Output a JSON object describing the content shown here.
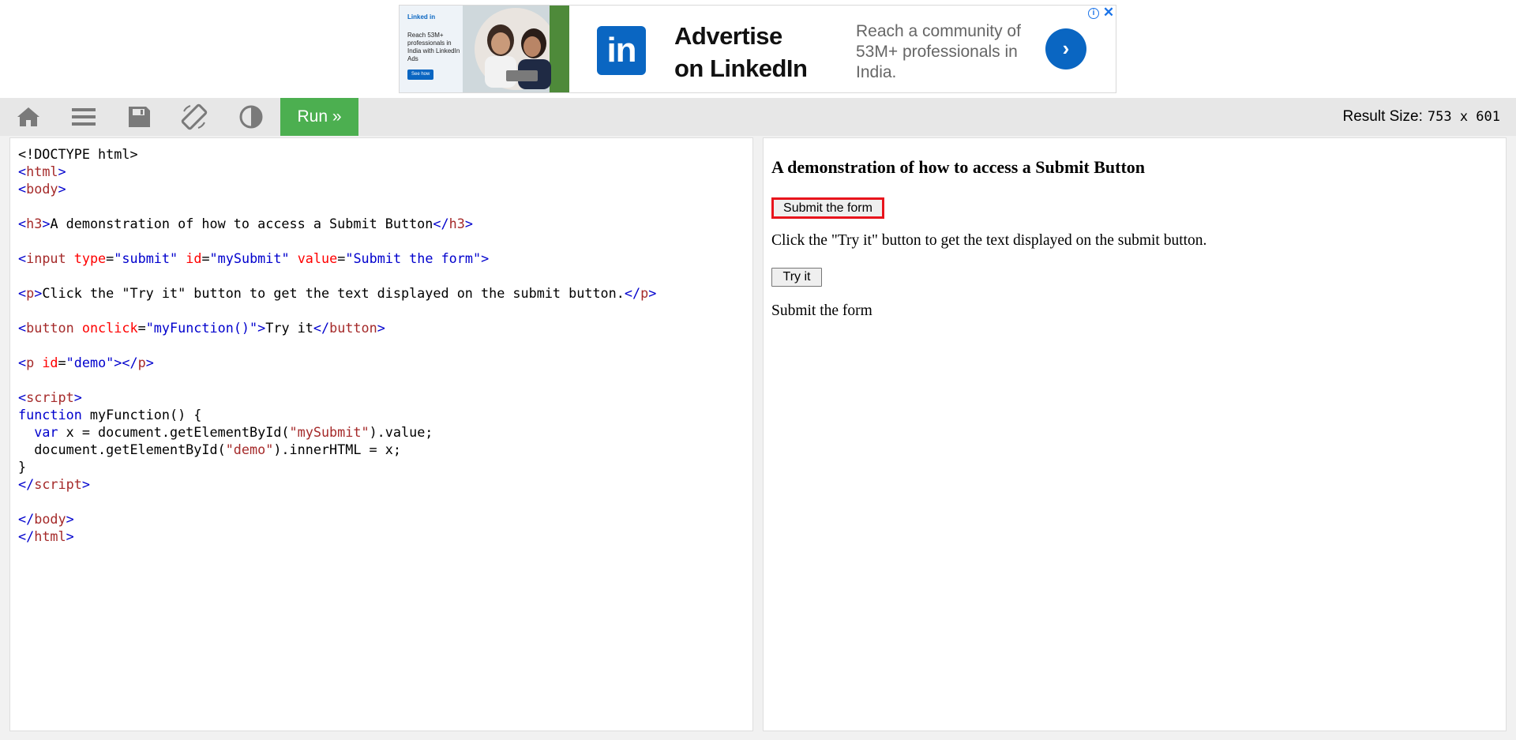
{
  "ad": {
    "thumb_brand": "Linked in",
    "thumb_headline": "Reach 53M+ professionals in India with LinkedIn Ads",
    "thumb_cta": "See how",
    "logo_text": "in",
    "title": "Advertise on LinkedIn",
    "description": "Reach a community of 53M+ professionals in India.",
    "arrow": "›",
    "info": "i",
    "close": "✕"
  },
  "toolbar": {
    "icons": [
      "home-icon",
      "menu-icon",
      "save-icon",
      "rotate-icon",
      "contrast-icon"
    ],
    "run_label": "Run »",
    "result_size_label": "Result Size:",
    "result_size_value": "753 x 601"
  },
  "colors": {
    "tag": "#a52a2a",
    "bracket": "#0000cd",
    "attr": "#ff0000",
    "value": "#0000cd",
    "keyword": "#0000cd",
    "string": "#a52a2a",
    "run_green": "#4caf50",
    "highlight_red": "#e8141c"
  },
  "code_lines": [
    [
      [
        "t",
        "<!DOCTYPE html>"
      ]
    ],
    [
      [
        "b",
        "<"
      ],
      [
        "g",
        "html"
      ],
      [
        "b",
        ">"
      ]
    ],
    [
      [
        "b",
        "<"
      ],
      [
        "g",
        "body"
      ],
      [
        "b",
        ">"
      ]
    ],
    [],
    [
      [
        "b",
        "<"
      ],
      [
        "g",
        "h3"
      ],
      [
        "b",
        ">"
      ],
      [
        "t",
        "A demonstration of how to access a Submit Button"
      ],
      [
        "b",
        "</"
      ],
      [
        "g",
        "h3"
      ],
      [
        "b",
        ">"
      ]
    ],
    [],
    [
      [
        "b",
        "<"
      ],
      [
        "g",
        "input"
      ],
      [
        "t",
        " "
      ],
      [
        "a",
        "type"
      ],
      [
        "t",
        "="
      ],
      [
        "v",
        "\"submit\""
      ],
      [
        "t",
        " "
      ],
      [
        "a",
        "id"
      ],
      [
        "t",
        "="
      ],
      [
        "v",
        "\"mySubmit\""
      ],
      [
        "t",
        " "
      ],
      [
        "a",
        "value"
      ],
      [
        "t",
        "="
      ],
      [
        "v",
        "\"Submit the form\""
      ],
      [
        "b",
        ">"
      ]
    ],
    [],
    [
      [
        "b",
        "<"
      ],
      [
        "g",
        "p"
      ],
      [
        "b",
        ">"
      ],
      [
        "t",
        "Click the \"Try it\" button to get the text displayed on the submit button."
      ],
      [
        "b",
        "</"
      ],
      [
        "g",
        "p"
      ],
      [
        "b",
        ">"
      ]
    ],
    [],
    [
      [
        "b",
        "<"
      ],
      [
        "g",
        "button"
      ],
      [
        "t",
        " "
      ],
      [
        "a",
        "onclick"
      ],
      [
        "t",
        "="
      ],
      [
        "v",
        "\"myFunction()\""
      ],
      [
        "b",
        ">"
      ],
      [
        "t",
        "Try it"
      ],
      [
        "b",
        "</"
      ],
      [
        "g",
        "button"
      ],
      [
        "b",
        ">"
      ]
    ],
    [],
    [
      [
        "b",
        "<"
      ],
      [
        "g",
        "p"
      ],
      [
        "t",
        " "
      ],
      [
        "a",
        "id"
      ],
      [
        "t",
        "="
      ],
      [
        "v",
        "\"demo\""
      ],
      [
        "b",
        "></"
      ],
      [
        "g",
        "p"
      ],
      [
        "b",
        ">"
      ]
    ],
    [],
    [
      [
        "b",
        "<"
      ],
      [
        "g",
        "script"
      ],
      [
        "b",
        ">"
      ]
    ],
    [
      [
        "k",
        "function"
      ],
      [
        "t",
        " myFunction() {"
      ]
    ],
    [
      [
        "t",
        "  "
      ],
      [
        "k",
        "var"
      ],
      [
        "t",
        " x = document.getElementById("
      ],
      [
        "s",
        "\"mySubmit\""
      ],
      [
        "t",
        ").value;"
      ]
    ],
    [
      [
        "t",
        "  document.getElementById("
      ],
      [
        "s",
        "\"demo\""
      ],
      [
        "t",
        ").innerHTML = x;"
      ]
    ],
    [
      [
        "t",
        "}"
      ]
    ],
    [
      [
        "b",
        "</"
      ],
      [
        "g",
        "script"
      ],
      [
        "b",
        ">"
      ]
    ],
    [],
    [
      [
        "b",
        "</"
      ],
      [
        "g",
        "body"
      ],
      [
        "b",
        ">"
      ]
    ],
    [
      [
        "b",
        "</"
      ],
      [
        "g",
        "html"
      ],
      [
        "b",
        ">"
      ]
    ]
  ],
  "result": {
    "heading": "A demonstration of how to access a Submit Button",
    "submit_value": "Submit the form",
    "paragraph": "Click the \"Try it\" button to get the text displayed on the submit button.",
    "try_button": "Try it",
    "demo_text": "Submit the form"
  }
}
